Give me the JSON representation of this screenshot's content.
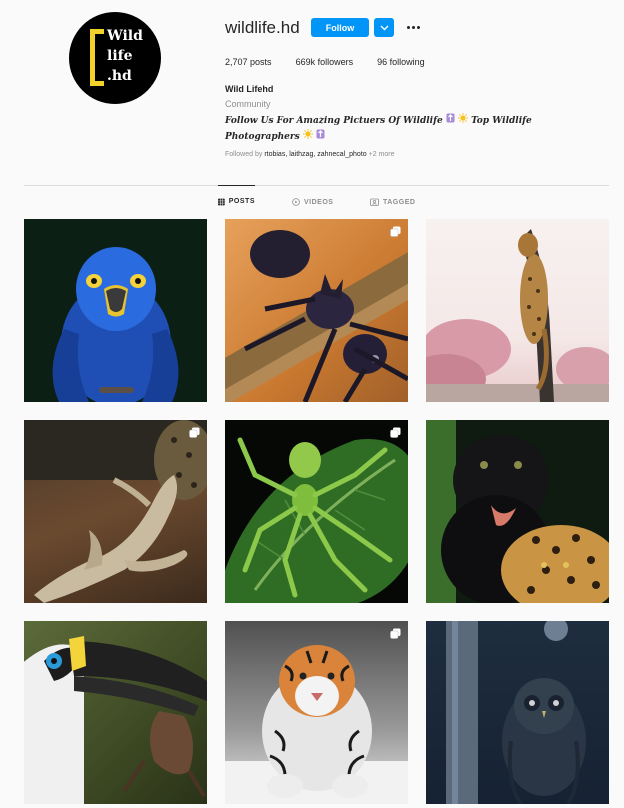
{
  "profile": {
    "avatar_lines": [
      "Wild",
      "life",
      ".hd"
    ],
    "username": "wildlife.hd",
    "follow_label": "Follow",
    "stats": {
      "posts": "2,707",
      "posts_label": "posts",
      "followers": "669k",
      "followers_label": "followers",
      "following": "96",
      "following_label": "following"
    },
    "full_name": "Wild Lifehd",
    "category": "Community",
    "bio_line1": "Follow Us For Amazing Pictuers Of Wildlife",
    "bio_line1_tail": "Top Wildlife",
    "bio_line2": "Photographers",
    "followed_by_prefix": "Followed by",
    "followed_by_names": "rtobias, laithzag, zahnecal_photo",
    "followed_by_more": "+2 more"
  },
  "tabs": [
    {
      "label": "POSTS",
      "icon": "grid-icon",
      "active": true
    },
    {
      "label": "VIDEOS",
      "icon": "video-icon",
      "active": false
    },
    {
      "label": "TAGGED",
      "icon": "tag-icon",
      "active": false
    }
  ],
  "colors": {
    "accent": "#0095f6",
    "text": "#262626",
    "muted": "#8e8e8e",
    "background": "#fafafa",
    "divider": "#dbdbdb",
    "logo_yellow": "#f2d22a"
  },
  "grid": {
    "posts": [
      {
        "subject": "blue macaw",
        "multi": false
      },
      {
        "subject": "black ant",
        "multi": true
      },
      {
        "subject": "leopard on tree",
        "multi": false
      },
      {
        "subject": "jaguar and lizard",
        "multi": true
      },
      {
        "subject": "green spider",
        "multi": true
      },
      {
        "subject": "black panther and jaguar",
        "multi": false
      },
      {
        "subject": "toucan with bat",
        "multi": false
      },
      {
        "subject": "running tiger",
        "multi": true
      },
      {
        "subject": "owl at night",
        "multi": false
      }
    ]
  }
}
